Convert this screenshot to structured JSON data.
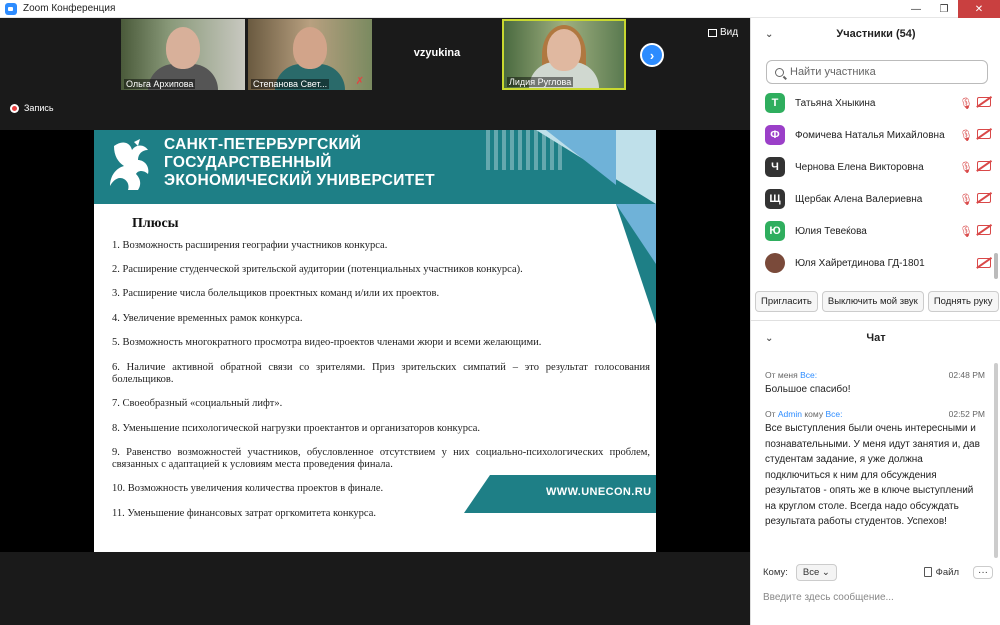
{
  "window": {
    "title": "Zoom Конференция",
    "controls": [
      "—",
      "❐",
      "✕"
    ]
  },
  "gallery": {
    "thumbs": [
      {
        "name": "Ольга Архипова"
      },
      {
        "name": "Степанова Свет..."
      },
      {
        "name": "vzyukina"
      },
      {
        "name": "Лидия Руглова"
      }
    ],
    "next_icon": "›",
    "view_label": "Вид"
  },
  "recording": {
    "label": "Запись"
  },
  "slide": {
    "university": [
      "САНКТ-ПЕТЕРБУРГСКИЙ",
      "ГОСУДАРСТВЕННЫЙ",
      "ЭКОНОМИЧЕСКИЙ УНИВЕРСИТЕТ"
    ],
    "title": "Плюсы",
    "items": [
      "1. Возможность расширения географии участников конкурса.",
      "2. Расширение студенческой зрительской аудитории (потенциальных участников конкурса).",
      "3. Расширение числа болельщиков проектных команд и/или их проектов.",
      "4. Увеличение временных рамок конкурса.",
      "5. Возможность многократного просмотра видео-проектов членами жюри и всеми желающими.",
      "6. Наличие активной обратной связи со зрителями. Приз зрительских симпатий – это результат голосования болельщиков.",
      "7. Своеобразный «социальный лифт».",
      "8. Уменьшение психологической нагрузки проектантов и организаторов конкурса.",
      "9. Равенство возможностей участников, обусловленное отсутствием у них социально-психологических проблем, связанных с адаптацией к условиям места проведения финала.",
      "10. Возможность увеличения количества проектов в финале.",
      "11. Уменьшение финансовых затрат оргкомитета конкурса."
    ],
    "url": "WWW.UNECON.RU"
  },
  "participants": {
    "header": "Участники (54)",
    "search_placeholder": "Найти участника",
    "list": [
      {
        "initial": "Т",
        "name": "Татьяна Хныкина",
        "color": "#2fae5e",
        "mic_muted": true
      },
      {
        "initial": "Ф",
        "name": "Фомичева Наталья Михайловна",
        "color": "#9b3fc8",
        "mic_muted": true
      },
      {
        "initial": "Ч",
        "name": "Чернова Елена Викторовна",
        "color": "#333333",
        "mic_muted": true
      },
      {
        "initial": "Щ",
        "name": "Щербак Алена Валериевна",
        "color": "#333333",
        "mic_muted": true
      },
      {
        "initial": "Ю",
        "name": "Юлия Тевеќова",
        "color": "#2fae5e",
        "mic_muted": true
      },
      {
        "initial": "",
        "name": "Юля Хайретдинова ГД-1801",
        "color": "#7a4a3a",
        "mic_muted": false
      }
    ],
    "actions": [
      "Пригласить",
      "Выключить мой звук",
      "Поднять руку"
    ]
  },
  "chat": {
    "header": "Чат",
    "messages": [
      {
        "from_prefix": "От меня",
        "to": "Все:",
        "kom_u": "",
        "time": "02:48 PM",
        "text": "Большое спасибо!"
      },
      {
        "from_prefix": "От",
        "sender": "Admin",
        "kom_u": "кому",
        "to": "Все:",
        "time": "02:52 PM",
        "text": "Все выступления были очень интересными и познавательными. У меня идут занятия и, дав студентам задание, я уже должна подключиться к ним для обсуждения результатов - опять же в ключе выступлений на круглом столе. Всегда надо обсуждать результата работы студентов. Успехов!"
      }
    ],
    "to_label": "Кому:",
    "to_value": "Все",
    "file_label": "Файл",
    "more_label": "···",
    "input_placeholder": "Введите здесь сообщение..."
  }
}
